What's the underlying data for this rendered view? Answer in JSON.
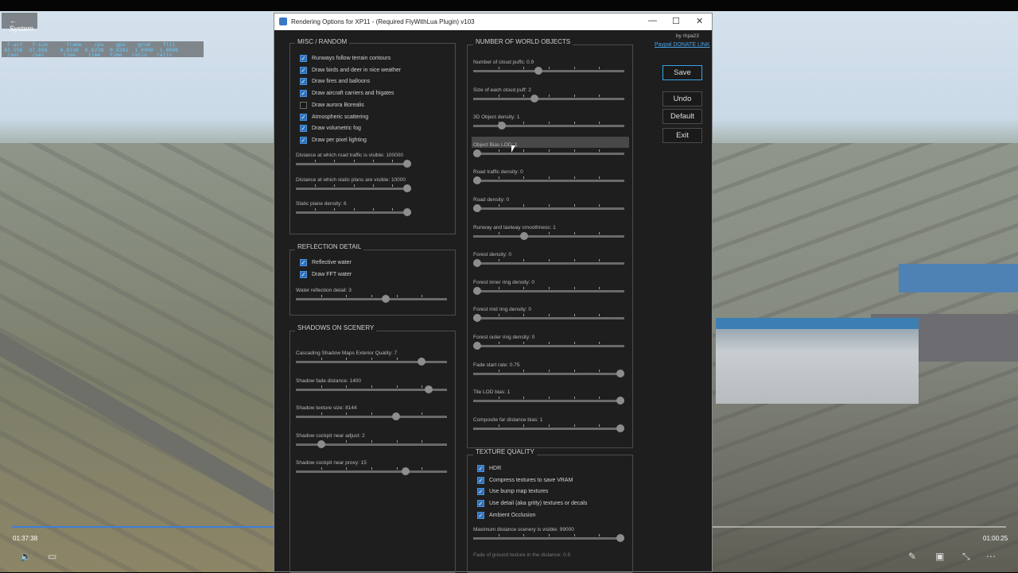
{
  "app": {
    "title": "Rendering Options for XP11 - (Required FlyWithLua Plugin) v103",
    "credit": "by rhpa23",
    "donate_link": "Paypal DONATE LINK"
  },
  "os": {
    "back_label": "System"
  },
  "stats": {
    "line1": " f-act   f-sim      frame    cpu    gpu    grnd    flit",
    "line2": "43.556  37.056    0.0230  0.0238  0.0201  1.0000  1.0000",
    "line3": " /sec    /sec      time    time   time   ratio   ratio"
  },
  "buttons": {
    "save": "Save",
    "undo": "Undo",
    "default": "Default",
    "exit": "Exit"
  },
  "misc": {
    "title": "MISC / RANDOM",
    "checks": [
      {
        "label": "Runways follow terrain contours",
        "on": true
      },
      {
        "label": "Draw birds and deer in nice weather",
        "on": true
      },
      {
        "label": "Draw fires and balloons",
        "on": true
      },
      {
        "label": "Draw aircraft carriers and frigates",
        "on": true
      },
      {
        "label": "Draw aurora Borealis",
        "on": false
      },
      {
        "label": "Atmospheric scattering",
        "on": true
      },
      {
        "label": "Draw volumetric fog",
        "on": true
      },
      {
        "label": "Draw per pixel lighting",
        "on": true
      }
    ],
    "sliders": [
      {
        "label": "Distance at which road traffic is visible: 100000",
        "value": 1.0
      },
      {
        "label": "Distance at which static plans are visible: 10000",
        "value": 1.0
      },
      {
        "label": "Static plane density: 6",
        "value": 1.0
      }
    ]
  },
  "reflection": {
    "title": "REFLECTION DETAIL",
    "checks": [
      {
        "label": "Reflective water",
        "on": true
      },
      {
        "label": "Draw FFT water",
        "on": true
      }
    ],
    "sliders": [
      {
        "label": "Water reflection detail: 3",
        "value": 0.6
      }
    ]
  },
  "shadows": {
    "title": "SHADOWS ON SCENERY",
    "sliders": [
      {
        "label": "Cascading Shadow Maps Exterior Quality: 7",
        "value": 0.85
      },
      {
        "label": "Shadow fade distance: 1400",
        "value": 0.9
      },
      {
        "label": "Shadow texture size: 8144",
        "value": 0.67
      },
      {
        "label": "Shadow cockpit near adjust: 2",
        "value": 0.15
      },
      {
        "label": "Shadow cockpit near proxy: 15",
        "value": 0.74
      }
    ]
  },
  "world": {
    "title": "NUMBER OF WORLD OBJECTS",
    "sliders": [
      {
        "label": "Number of cloud puffs: 0.9",
        "value": 0.43
      },
      {
        "label": "Size of each cloud puff: 2",
        "value": 0.4
      },
      {
        "label": "3D Object density: 1",
        "value": 0.17
      },
      {
        "label": "Object Bias LOD: 1",
        "value": 0.0
      },
      {
        "label": "Road traffic density: 0",
        "value": 0.0
      },
      {
        "label": "Road density: 0",
        "value": 0.0
      },
      {
        "label": "Runway and taxiway smoothness: 1",
        "value": 0.33
      },
      {
        "label": "Forest density: 0",
        "value": 0.0
      },
      {
        "label": "Forest inner ring density: 0",
        "value": 0.0
      },
      {
        "label": "Forest mid ring density: 0",
        "value": 0.0
      },
      {
        "label": "Forest outer ring density: 0",
        "value": 0.0
      },
      {
        "label": "Fade start rate: 0.75",
        "value": 1.0
      },
      {
        "label": "Tile LOD bias: 1",
        "value": 1.0
      },
      {
        "label": "Composite far distance bias: 1",
        "value": 1.0
      }
    ]
  },
  "texture": {
    "title": "TEXTURE QUALITY",
    "checks": [
      {
        "label": "HDR",
        "on": true
      },
      {
        "label": "Compress textures to save VRAM",
        "on": true
      },
      {
        "label": "Use bump map textures",
        "on": true
      },
      {
        "label": "Use detail (aka gritty) textures or decals",
        "on": true
      },
      {
        "label": "Ambient Occlusion",
        "on": true
      }
    ],
    "sliders": [
      {
        "label": "Maximum distance scenery is visible: 99000",
        "value": 1.0
      }
    ],
    "partial_label": "Fade of ground texture in the distance: 0.9"
  },
  "video": {
    "elapsed": "01:37:38",
    "remaining": "01:00:25",
    "progress": 0.62
  }
}
